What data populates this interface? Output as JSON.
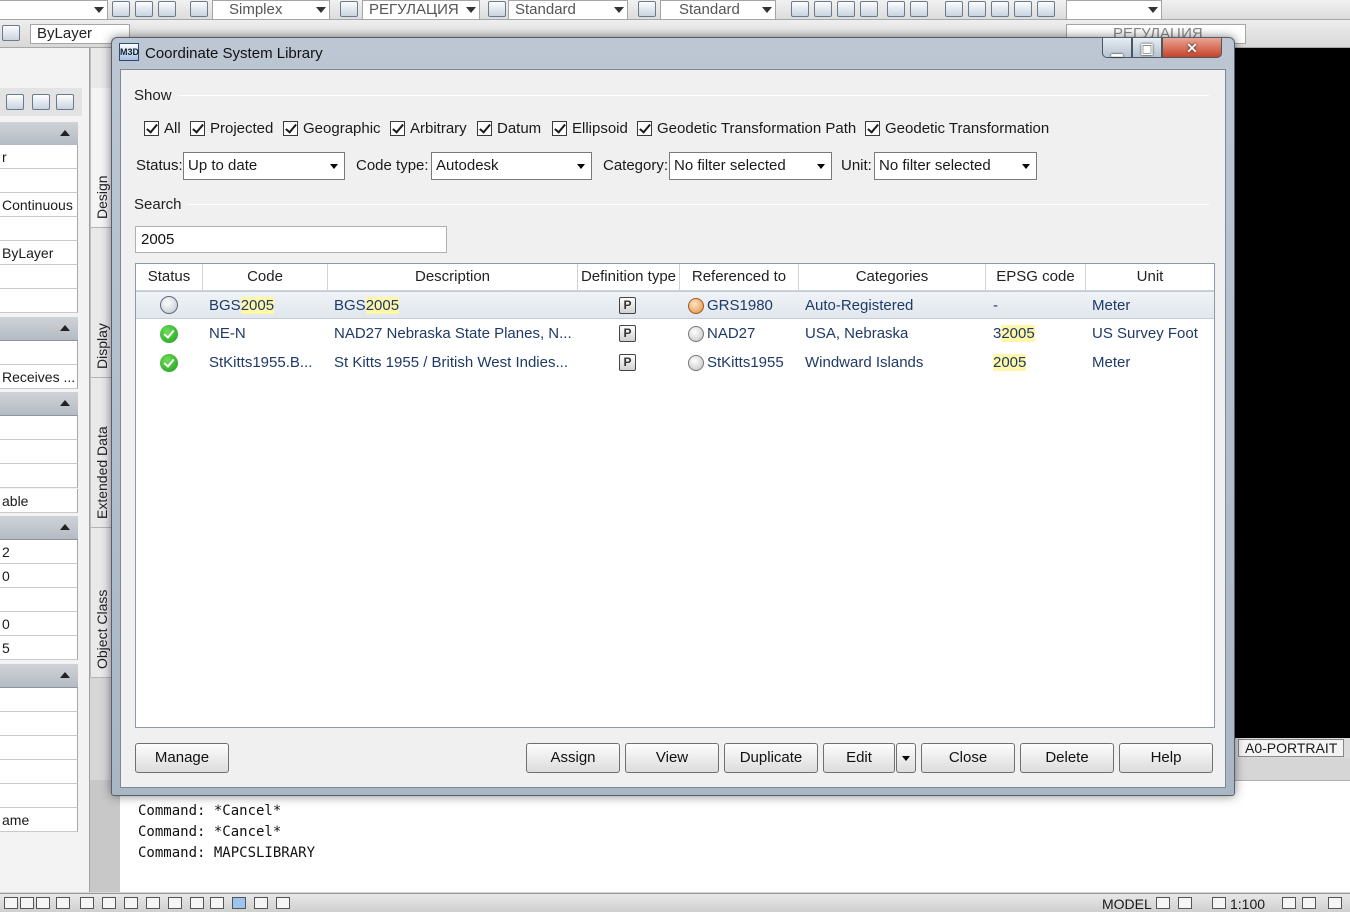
{
  "toolbar": {
    "text_style": "Simplex",
    "layer_combo": "РЕГУЛАЦИЯ",
    "dim_style": "Standard",
    "table_style": "Standard",
    "color_combo": "ByLayer",
    "layer_combo2": "РЕГУЛАЦИЯ"
  },
  "left_palette": {
    "rows": [
      "r",
      "",
      "Continuous",
      "",
      "ByLayer",
      "",
      "",
      "",
      "Receives ...",
      "",
      "",
      "",
      "able",
      "2",
      "0",
      "",
      "0",
      "5",
      "",
      "",
      "",
      "",
      "",
      "",
      "ame"
    ]
  },
  "vertical_tabs": [
    "Design",
    "Display",
    "Extended Data",
    "Object Class"
  ],
  "layout_tab": "A0-PORTRAIT",
  "command_line": [
    "Command: *Cancel*",
    "Command: *Cancel*",
    "Command: MAPCSLIBRARY"
  ],
  "status_bar": {
    "model": "MODEL",
    "scale": "1:100"
  },
  "dialog": {
    "title": "Coordinate System Library",
    "show_label": "Show",
    "checkboxes": [
      "All",
      "Projected",
      "Geographic",
      "Arbitrary",
      "Datum",
      "Ellipsoid",
      "Geodetic Transformation Path",
      "Geodetic Transformation"
    ],
    "filters": {
      "status_label": "Status:",
      "status_value": "Up to date",
      "code_type_label": "Code type:",
      "code_type_value": "Autodesk",
      "category_label": "Category:",
      "category_value": "No filter selected",
      "unit_label": "Unit:",
      "unit_value": "No filter selected"
    },
    "search_label": "Search",
    "search_value": "2005",
    "columns": [
      "Status",
      "Code",
      "Description",
      "Definition type",
      "Referenced to",
      "Categories",
      "EPSG code",
      "Unit"
    ],
    "rows": [
      {
        "status": "auto",
        "code_pre": "BGS",
        "code_hl": "2005",
        "desc_pre": "BGS",
        "desc_hl": "2005",
        "def": "P",
        "ref": "GRS1980",
        "cat": "Auto-Registered",
        "epsg_pre": "-",
        "epsg_hl": "",
        "unit": "Meter"
      },
      {
        "status": "ok",
        "code_pre": "NE-N",
        "code_hl": "",
        "desc_pre": "NAD27 Nebraska State Planes, N...",
        "desc_hl": "",
        "def": "P",
        "ref": "NAD27",
        "cat": "USA, Nebraska",
        "epsg_pre": "3",
        "epsg_hl": "2005",
        "unit": "US Survey Foot"
      },
      {
        "status": "ok",
        "code_pre": "StKitts1955.B...",
        "code_hl": "",
        "desc_pre": "St Kitts 1955 / British West Indies...",
        "desc_hl": "",
        "def": "P",
        "ref": "StKitts1955",
        "cat": "Windward Islands",
        "epsg_pre": "",
        "epsg_hl": "2005",
        "unit": "Meter"
      }
    ],
    "buttons": {
      "manage": "Manage",
      "assign": "Assign",
      "view": "View",
      "duplicate": "Duplicate",
      "edit": "Edit",
      "close": "Close",
      "delete": "Delete",
      "help": "Help"
    }
  }
}
